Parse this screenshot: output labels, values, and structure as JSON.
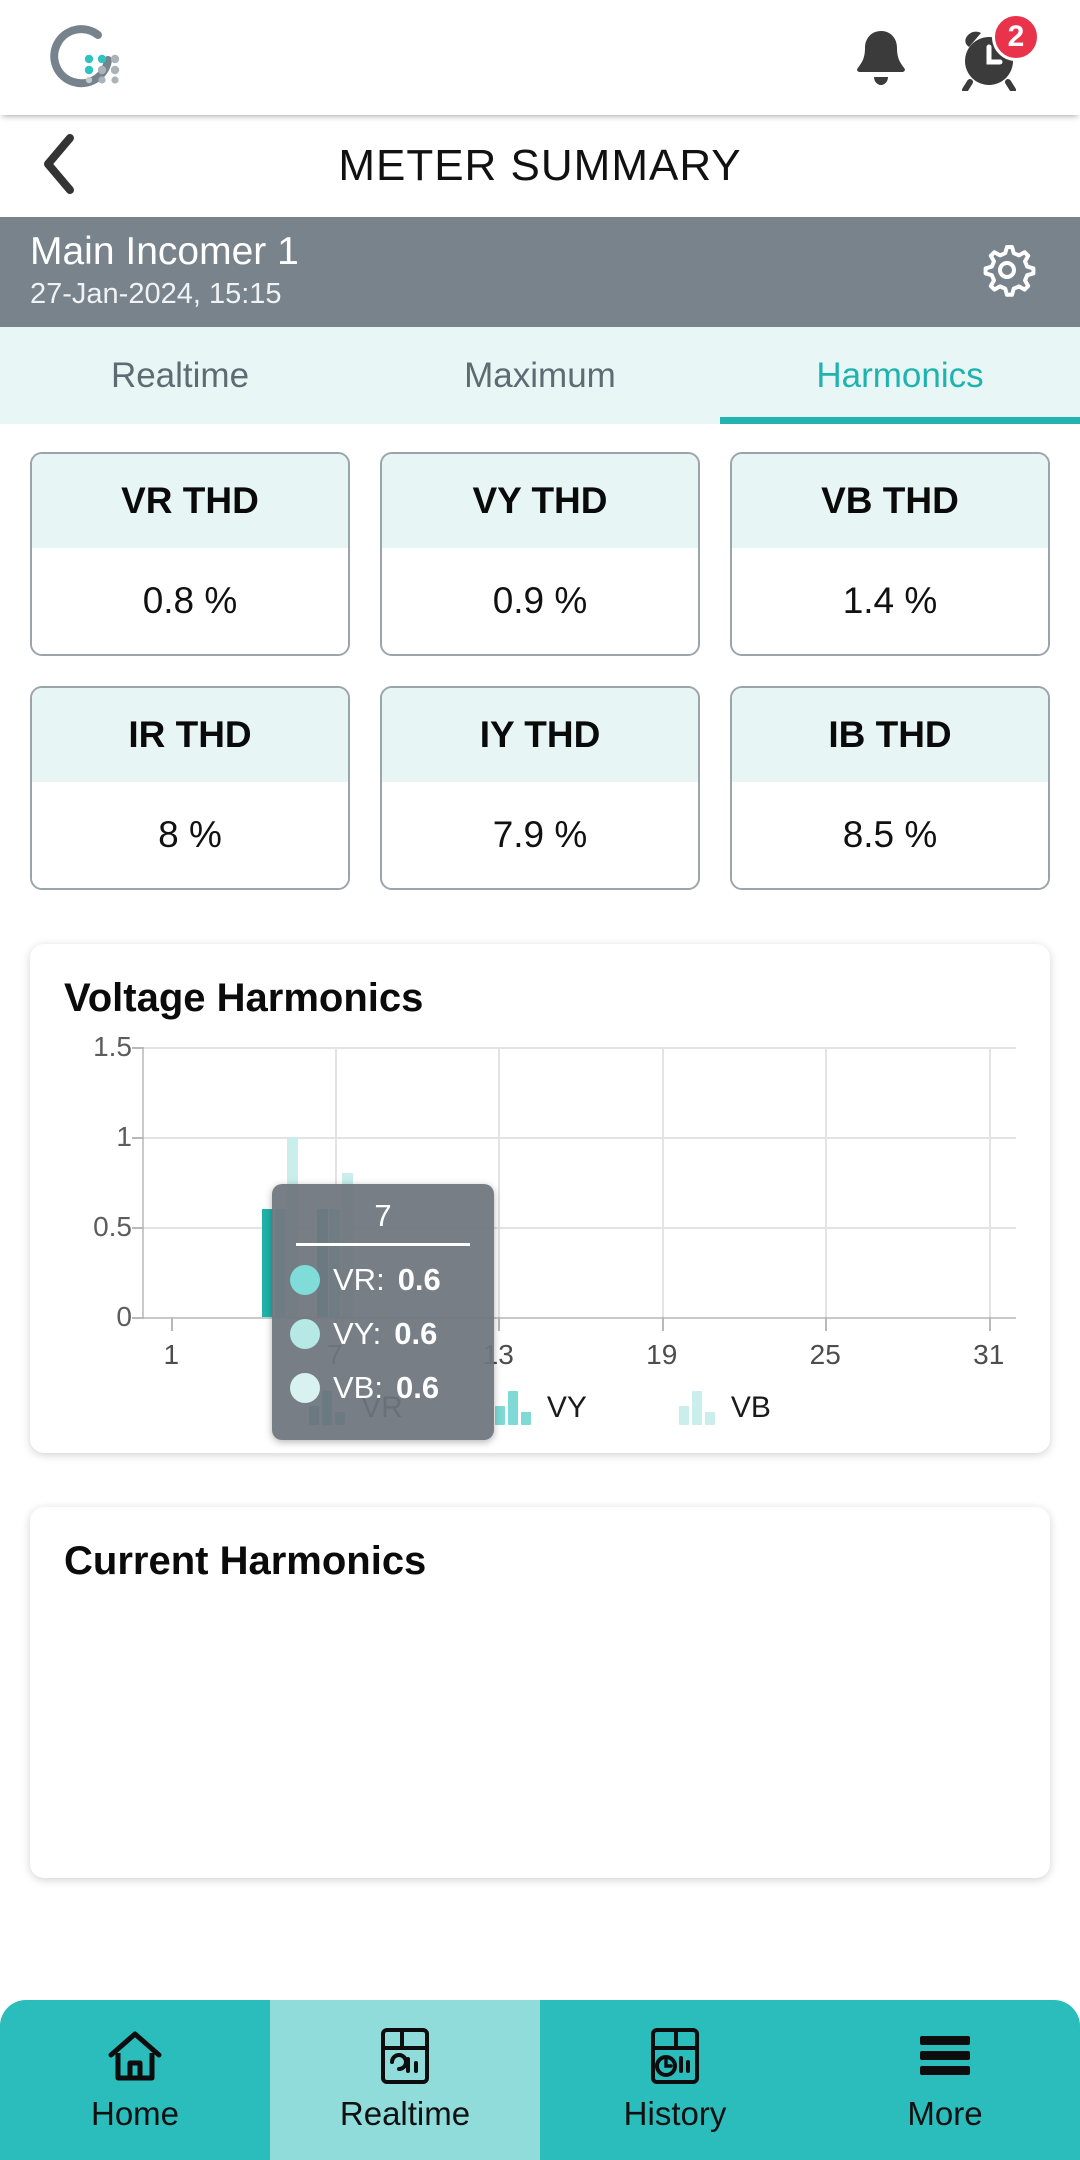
{
  "appbar": {
    "logo_name": "cuelogic-circle-logo",
    "notification_icon": "bell-icon",
    "alarm_icon": "alarm-clock-icon",
    "alarm_badge": "2",
    "badge_color": "#e8334a"
  },
  "titlebar": {
    "back_icon": "chevron-left-icon",
    "title": "METER SUMMARY"
  },
  "meter": {
    "name": "Main Incomer 1",
    "datetime": "27-Jan-2024, 15:15",
    "settings_icon": "gear-icon",
    "bar_color": "#78838c"
  },
  "tabs": {
    "items": [
      {
        "label": "Realtime",
        "active": false
      },
      {
        "label": "Maximum",
        "active": false
      },
      {
        "label": "Harmonics",
        "active": true
      }
    ],
    "active_color": "#22b3b0",
    "background": "#e8f7f6"
  },
  "thd_cards": [
    {
      "label": "VR THD",
      "value": "0.8 %"
    },
    {
      "label": "VY THD",
      "value": "0.9 %"
    },
    {
      "label": "VB THD",
      "value": "1.4 %"
    },
    {
      "label": "IR THD",
      "value": "8 %"
    },
    {
      "label": "IY THD",
      "value": "7.9 %"
    },
    {
      "label": "IB THD",
      "value": "8.5 %"
    }
  ],
  "chart_data": [
    {
      "type": "bar",
      "title": "Voltage Harmonics",
      "xlabel": "",
      "ylabel": "",
      "ylim": [
        0,
        1.5
      ],
      "yticks": [
        "0",
        "0.5",
        "1",
        "1.5"
      ],
      "ytick_values": [
        0,
        0.5,
        1,
        1.5
      ],
      "xticks": [
        "1",
        "7",
        "13",
        "19",
        "25",
        "31"
      ],
      "xtick_values": [
        1,
        7,
        13,
        19,
        25,
        31
      ],
      "xlim": [
        0,
        32
      ],
      "grid": true,
      "legend_position": "bottom",
      "series": [
        {
          "name": "VR",
          "color": "#20b2aa",
          "x": [
            5,
            7
          ],
          "values": [
            0.6,
            0.6
          ]
        },
        {
          "name": "VY",
          "color": "#7fd9d4",
          "x": [
            5,
            7
          ],
          "values": [
            0.6,
            0.6
          ]
        },
        {
          "name": "VB",
          "color": "#c9eeec",
          "x": [
            5,
            7
          ],
          "values": [
            1.0,
            0.8
          ]
        }
      ]
    },
    {
      "type": "bar",
      "title": "Current Harmonics",
      "xlabel": "",
      "ylabel": "",
      "series": []
    }
  ],
  "tooltip": {
    "title": "7",
    "rows": [
      {
        "label": "VR:",
        "value": "0.6",
        "color": "#7fdcd8"
      },
      {
        "label": "VY:",
        "value": "0.6",
        "color": "#b6e8e6"
      },
      {
        "label": "VB:",
        "value": "0.6",
        "color": "#d8f2f1"
      }
    ]
  },
  "bottomnav": {
    "items": [
      {
        "label": "Home",
        "icon": "home-icon",
        "active": false
      },
      {
        "label": "Realtime",
        "icon": "meter-gauge-icon",
        "active": true
      },
      {
        "label": "History",
        "icon": "history-chart-icon",
        "active": false
      },
      {
        "label": "More",
        "icon": "hamburger-menu-icon",
        "active": false
      }
    ],
    "background": "#2bbcbc",
    "active_background": "#8fdcda"
  }
}
